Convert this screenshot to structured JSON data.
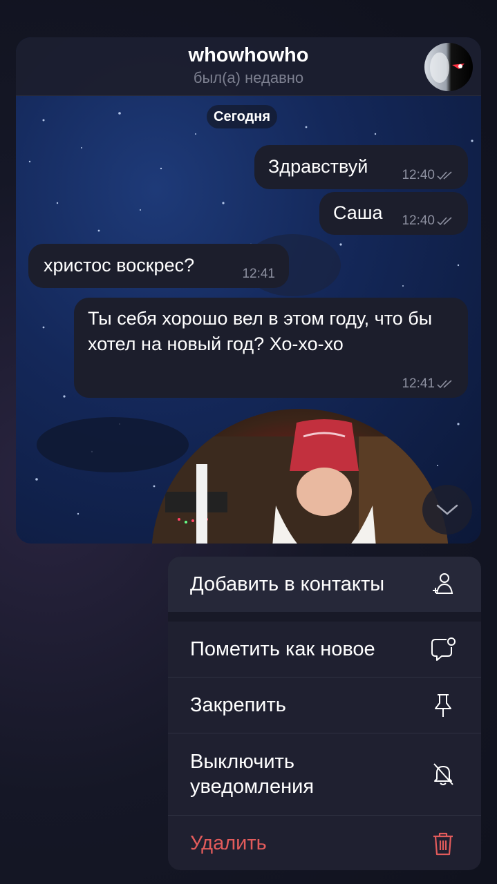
{
  "chat": {
    "title": "whowhowho",
    "status": "был(а) недавно",
    "date_label": "Сегодня"
  },
  "messages": [
    {
      "text": "Здравствуй",
      "time": "12:40",
      "outgoing": true,
      "read": true
    },
    {
      "text": "Саша",
      "time": "12:40",
      "outgoing": true,
      "read": true
    },
    {
      "text": "христос воскрес?",
      "time": "12:41",
      "outgoing": false
    },
    {
      "text": "Ты себя хорошо вел в этом году, что бы хотел на новый год? Хо-хо-хо",
      "time": "12:41",
      "outgoing": true,
      "read": true
    }
  ],
  "menu": {
    "add_contact": {
      "label": "Добавить в контакты",
      "icon": "add-contact-icon"
    },
    "mark_unread": {
      "label": "Пометить как новое",
      "icon": "chat-badge-icon"
    },
    "pin": {
      "label": "Закрепить",
      "icon": "pin-icon"
    },
    "mute": {
      "label": "Выключить уведомления",
      "icon": "bell-off-icon"
    },
    "delete": {
      "label": "Удалить",
      "icon": "trash-icon",
      "color": "#e25b5b"
    }
  },
  "colors": {
    "accent_delete": "#e25b5b",
    "bubble": "#1c1e2c",
    "menu_bg": "#1f2030"
  }
}
